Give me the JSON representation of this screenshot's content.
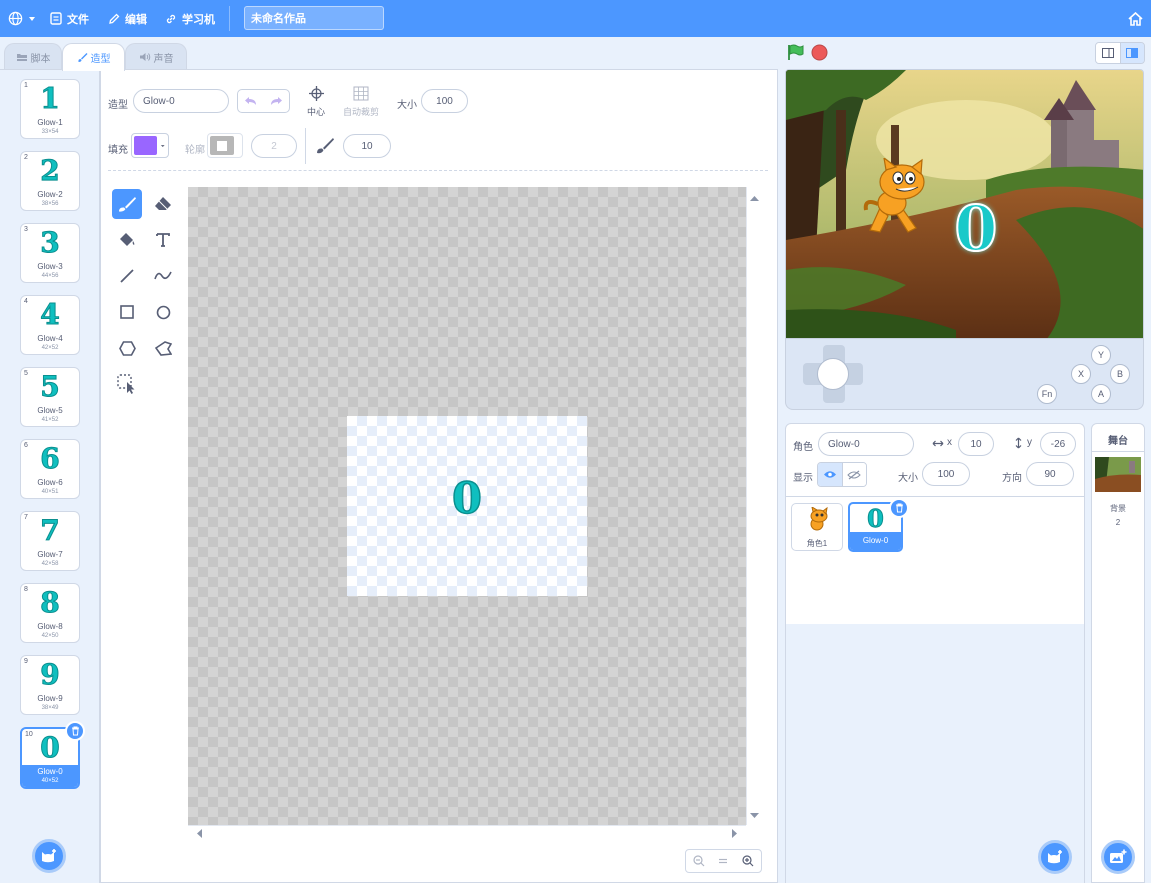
{
  "menu": {
    "file": "文件",
    "edit": "编辑",
    "learn": "学习机",
    "project_title": "未命名作品"
  },
  "tabs": {
    "code": "脚本",
    "costumes": "造型",
    "sounds": "声音"
  },
  "costumes": [
    {
      "num": "1",
      "glyph": "1",
      "name": "Glow-1",
      "size": "33×54"
    },
    {
      "num": "2",
      "glyph": "2",
      "name": "Glow-2",
      "size": "38×56"
    },
    {
      "num": "3",
      "glyph": "3",
      "name": "Glow-3",
      "size": "44×56"
    },
    {
      "num": "4",
      "glyph": "4",
      "name": "Glow-4",
      "size": "42×52"
    },
    {
      "num": "5",
      "glyph": "5",
      "name": "Glow-5",
      "size": "41×52"
    },
    {
      "num": "6",
      "glyph": "6",
      "name": "Glow-6",
      "size": "40×51"
    },
    {
      "num": "7",
      "glyph": "7",
      "name": "Glow-7",
      "size": "42×58"
    },
    {
      "num": "8",
      "glyph": "8",
      "name": "Glow-8",
      "size": "42×50"
    },
    {
      "num": "9",
      "glyph": "9",
      "name": "Glow-9",
      "size": "38×49"
    },
    {
      "num": "10",
      "glyph": "0",
      "name": "Glow-0",
      "size": "40×52"
    }
  ],
  "editor": {
    "costume_label": "造型",
    "costume_name": "Glow-0",
    "center_label": "中心",
    "autocrop_label": "自动裁剪",
    "size_label": "大小",
    "size_value": "100",
    "fill_label": "填充",
    "fill_color": "#9966ff",
    "outline_label": "轮廓",
    "outline_width": "2",
    "brush_size": "10"
  },
  "canvas_glyph": "0",
  "stage": {
    "glyph": "0"
  },
  "gamepad": {
    "y": "Y",
    "x": "X",
    "b": "B",
    "a": "A",
    "fn": "Fn"
  },
  "sprite_info": {
    "sprite_label": "角色",
    "sprite_name": "Glow-0",
    "x_label": "x",
    "x_value": "10",
    "y_label": "y",
    "y_value": "-26",
    "show_label": "显示",
    "size_label": "大小",
    "size_value": "100",
    "direction_label": "方向",
    "direction_value": "90"
  },
  "sprites": [
    {
      "name": "角色1"
    },
    {
      "name": "Glow-0",
      "glyph": "0"
    }
  ],
  "stage_panel": {
    "title": "舞台",
    "backdrop_label": "背景",
    "backdrop_count": "2"
  },
  "colors": {
    "accent": "#4c97ff",
    "glow": "#0fbfbf"
  }
}
